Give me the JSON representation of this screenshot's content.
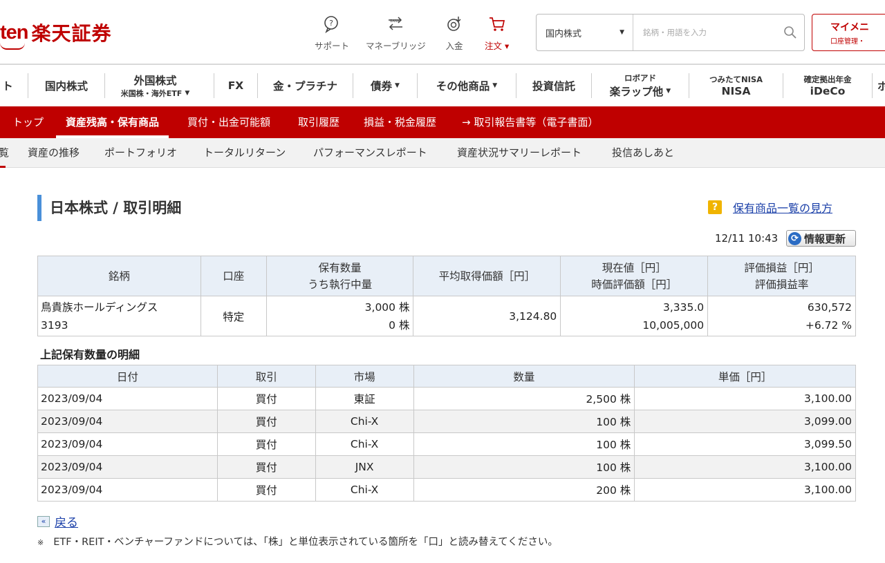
{
  "header": {
    "logo_latin": "ten",
    "logo_jp": "楽天証券",
    "icons": [
      {
        "name": "support-icon",
        "label": "サポート"
      },
      {
        "name": "bank-icon",
        "label": "マネーブリッジ"
      },
      {
        "name": "deposit-icon",
        "label": "入金"
      },
      {
        "name": "cart-icon",
        "label": "注文 ▾"
      }
    ],
    "search": {
      "category": "国内株式",
      "placeholder": "銘柄・用語を入力"
    },
    "mypage": {
      "label": "マイメニ",
      "sub": "口座管理・"
    }
  },
  "main_nav": {
    "items": [
      {
        "label": "ト"
      },
      {
        "label": "国内株式"
      },
      {
        "label": "外国株式",
        "sub": "米国株・海外ETF"
      },
      {
        "label": "FX"
      },
      {
        "label": "金・プラチナ"
      },
      {
        "label": "債券"
      },
      {
        "label": "その他商品"
      },
      {
        "label": "投資信託"
      },
      {
        "top": "ロボアド",
        "label": "楽ラップ他"
      },
      {
        "top": "つみたてNISA",
        "label": "NISA"
      },
      {
        "top": "確定拠出年金",
        "label": "iDeCo"
      },
      {
        "label": "ポ"
      }
    ]
  },
  "red_nav": {
    "items": [
      "トップ",
      "資産残高・保有商品",
      "買付・出金可能額",
      "取引履歴",
      "損益・税金履歴",
      "→ 取引報告書等（電子書面）"
    ]
  },
  "gray_nav": {
    "items": [
      "覧",
      "資産の推移",
      "ポートフォリオ",
      "トータルリターン",
      "パフォーマンスレポート",
      "資産状況サマリーレポート",
      "投信あしあと"
    ]
  },
  "content": {
    "title": "日本株式 / 取引明細",
    "help_link": "保有商品一覧の見方",
    "updated_at": "12/11 10:43",
    "refresh_label": "情報更新",
    "holding_table": {
      "headers": [
        [
          "銘柄"
        ],
        [
          "口座"
        ],
        [
          "保有数量",
          "うち執行中量"
        ],
        [
          "平均取得価額［円］"
        ],
        [
          "現在値［円］",
          "時価評価額［円］"
        ],
        [
          "評価損益［円］",
          "評価損益率"
        ]
      ],
      "row": {
        "name": "鳥貴族ホールディングス",
        "code": "3193",
        "account": "特定",
        "quantity": "3,000 株",
        "executing": "0 株",
        "avg_price": "3,124.80",
        "current_price": "3,335.0",
        "market_value": "10,005,000",
        "pl": "630,572",
        "pl_rate": "+6.72 %"
      }
    },
    "detail_title": "上記保有数量の明細",
    "detail_table": {
      "headers": [
        "日付",
        "取引",
        "市場",
        "数量",
        "単価［円］"
      ],
      "rows": [
        {
          "date": "2023/09/04",
          "trade": "買付",
          "market": "東証",
          "qty": "2,500 株",
          "price": "3,100.00"
        },
        {
          "date": "2023/09/04",
          "trade": "買付",
          "market": "Chi-X",
          "qty": "100 株",
          "price": "3,099.00"
        },
        {
          "date": "2023/09/04",
          "trade": "買付",
          "market": "Chi-X",
          "qty": "100 株",
          "price": "3,099.50"
        },
        {
          "date": "2023/09/04",
          "trade": "買付",
          "market": "JNX",
          "qty": "100 株",
          "price": "3,100.00"
        },
        {
          "date": "2023/09/04",
          "trade": "買付",
          "market": "Chi-X",
          "qty": "200 株",
          "price": "3,100.00"
        }
      ]
    },
    "back_label": "戻る",
    "note_mark": "※",
    "note": "ETF・REIT・ベンチャーファンドについては、「株」と単位表示されている箇所を「口」と読み替えてください。"
  },
  "colors": {
    "brand_red": "#bf0000",
    "header_bg": "#e8eff7",
    "link": "#1a3fa8",
    "title_bar": "#4a90d9"
  }
}
